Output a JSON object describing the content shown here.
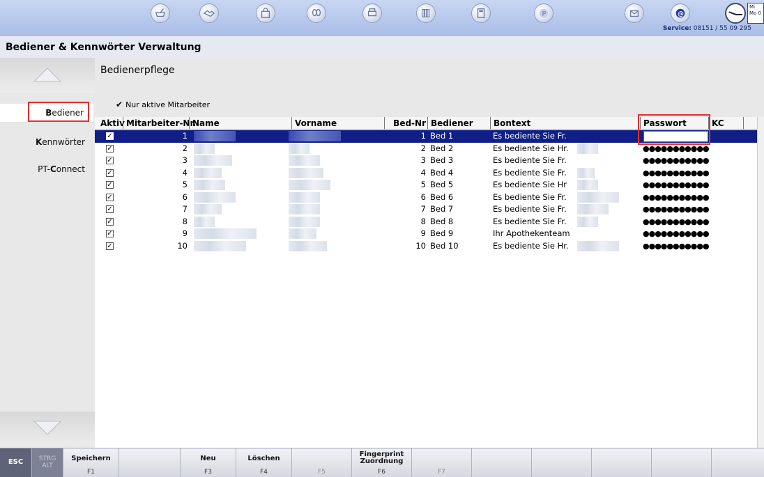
{
  "topbar": {
    "icons": [
      "mortar-icon",
      "handshake-icon",
      "shopping-bag-icon",
      "leaves-icon",
      "printer-icon",
      "books-icon",
      "calculator-icon",
      "p-icon",
      "mail-icon",
      "at-icon"
    ],
    "service_label": "Service:",
    "service_number": "08151 / 55 09 295",
    "calendar_top": "Mi",
    "calendar_bottom": "Mo 0"
  },
  "window_title": "Bediener & Kennwörter Verwaltung",
  "sidebar": {
    "items": [
      {
        "label_first": "B",
        "label_rest": "ediener",
        "active": true
      },
      {
        "label_first": "K",
        "label_rest": "ennwörter",
        "active": false
      },
      {
        "label_prefix": "PT-",
        "label_first": "C",
        "label_rest": "onnect",
        "active": false
      }
    ]
  },
  "main": {
    "section_title": "Bedienerpflege",
    "filter_check": "✔",
    "filter_label": "Nur aktive Mitarbeiter"
  },
  "table": {
    "columns": [
      "Aktiv",
      "Mitarbeiter-Nr.",
      "Name",
      "Vorname",
      "Bed-Nr",
      "Bediener",
      "Bontext",
      "Passwort",
      "KC"
    ],
    "password_mask": "●●●●●●●●●●●",
    "rows": [
      {
        "aktiv": "✓",
        "nr": "1",
        "bednr": "1",
        "bediener": "Bed 1",
        "bontext": "Es bediente Sie Fr.",
        "selected": true
      },
      {
        "aktiv": "✓",
        "nr": "2",
        "bednr": "2",
        "bediener": "Bed 2",
        "bontext": "Es bediente Sie Hr."
      },
      {
        "aktiv": "✓",
        "nr": "3",
        "bednr": "3",
        "bediener": "Bed 3",
        "bontext": "Es bediente Sie Fr."
      },
      {
        "aktiv": "✓",
        "nr": "4",
        "bednr": "4",
        "bediener": "Bed 4",
        "bontext": "Es bediente Sie Fr."
      },
      {
        "aktiv": "✓",
        "nr": "5",
        "bednr": "5",
        "bediener": "Bed 5",
        "bontext": "Es bediente Sie  Hr"
      },
      {
        "aktiv": "✓",
        "nr": "6",
        "bednr": "6",
        "bediener": "Bed 6",
        "bontext": "Es bediente Sie Fr."
      },
      {
        "aktiv": "✓",
        "nr": "7",
        "bednr": "7",
        "bediener": "Bed 7",
        "bontext": "Es bediente Sie Fr."
      },
      {
        "aktiv": "✓",
        "nr": "8",
        "bednr": "8",
        "bediener": "Bed 8",
        "bontext": "Es bediente Sie Fr."
      },
      {
        "aktiv": "✓",
        "nr": "9",
        "bednr": "9",
        "bediener": "Bed 9",
        "bontext": "Ihr Apothekenteam"
      },
      {
        "aktiv": "✓",
        "nr": "10",
        "bednr": "10",
        "bediener": "Bed 10",
        "bontext": "Es bediente Sie Hr."
      }
    ]
  },
  "fkeys": [
    {
      "label": "ESC",
      "key": ""
    },
    {
      "label": "STRG\nALT",
      "key": ""
    },
    {
      "label": "Speichern",
      "key": "F1"
    },
    {
      "label": "",
      "key": ""
    },
    {
      "label": "Neu",
      "key": "F3"
    },
    {
      "label": "Löschen",
      "key": "F4"
    },
    {
      "label": "",
      "key": "F5"
    },
    {
      "label": "Fingerprint\nZuordnung",
      "key": "F6"
    },
    {
      "label": "",
      "key": "F7"
    },
    {
      "label": "",
      "key": ""
    },
    {
      "label": "",
      "key": ""
    },
    {
      "label": "",
      "key": ""
    },
    {
      "label": "",
      "key": ""
    },
    {
      "label": "",
      "key": ""
    }
  ],
  "colors": {
    "selection": "#0f1f86",
    "highlight_box": "#e03030",
    "title_blue": "#142a6e"
  }
}
